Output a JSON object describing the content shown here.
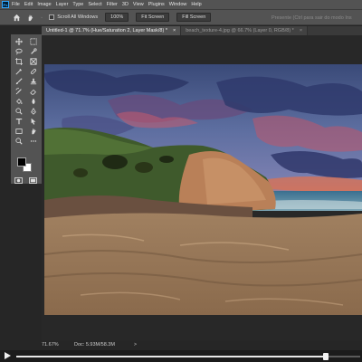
{
  "menubar": {
    "app_icon_text": "Ps",
    "items": [
      "File",
      "Edit",
      "Image",
      "Layer",
      "Type",
      "Select",
      "Filter",
      "3D",
      "View",
      "Plugins",
      "Window",
      "Help"
    ]
  },
  "options": {
    "scroll_all_windows": "Scroll All Windows",
    "zoom_value": "100%",
    "fit_screen": "Fit Screen",
    "fill_screen": "Fill Screen",
    "faded_text": "Presente (Ctrl para sair do modo Ins"
  },
  "tabs": [
    {
      "label": "Untitled-1 @ 71.7% (Hue/Saturation 2, Layer Mask/8) *",
      "active": true
    },
    {
      "label": "beach_texture-4.jpg @ 66.7% (Layer 0, RGB/8) *",
      "active": false
    }
  ],
  "tools": [
    "move-tool",
    "artboard-tool",
    "lasso-tool",
    "quick-selection-tool",
    "crop-tool",
    "frame-tool",
    "eyedropper-tool",
    "spot-healing-tool",
    "brush-tool",
    "clone-stamp-tool",
    "history-brush-tool",
    "eraser-tool",
    "paint-bucket-tool",
    "blur-tool",
    "dodge-tool",
    "pen-tool",
    "type-tool",
    "path-selection-tool",
    "rectangle-tool",
    "hand-tool",
    "zoom-tool",
    "more-tools"
  ],
  "colors": {
    "foreground": "#000000",
    "background": "#ffffff",
    "panel": "#535353",
    "workspace": "#282828"
  },
  "status": {
    "zoom": "71.67%",
    "doc_size": "Doc: 5.93M/58.3M",
    "arrow": ">"
  },
  "video": {
    "progress": 0.9
  }
}
